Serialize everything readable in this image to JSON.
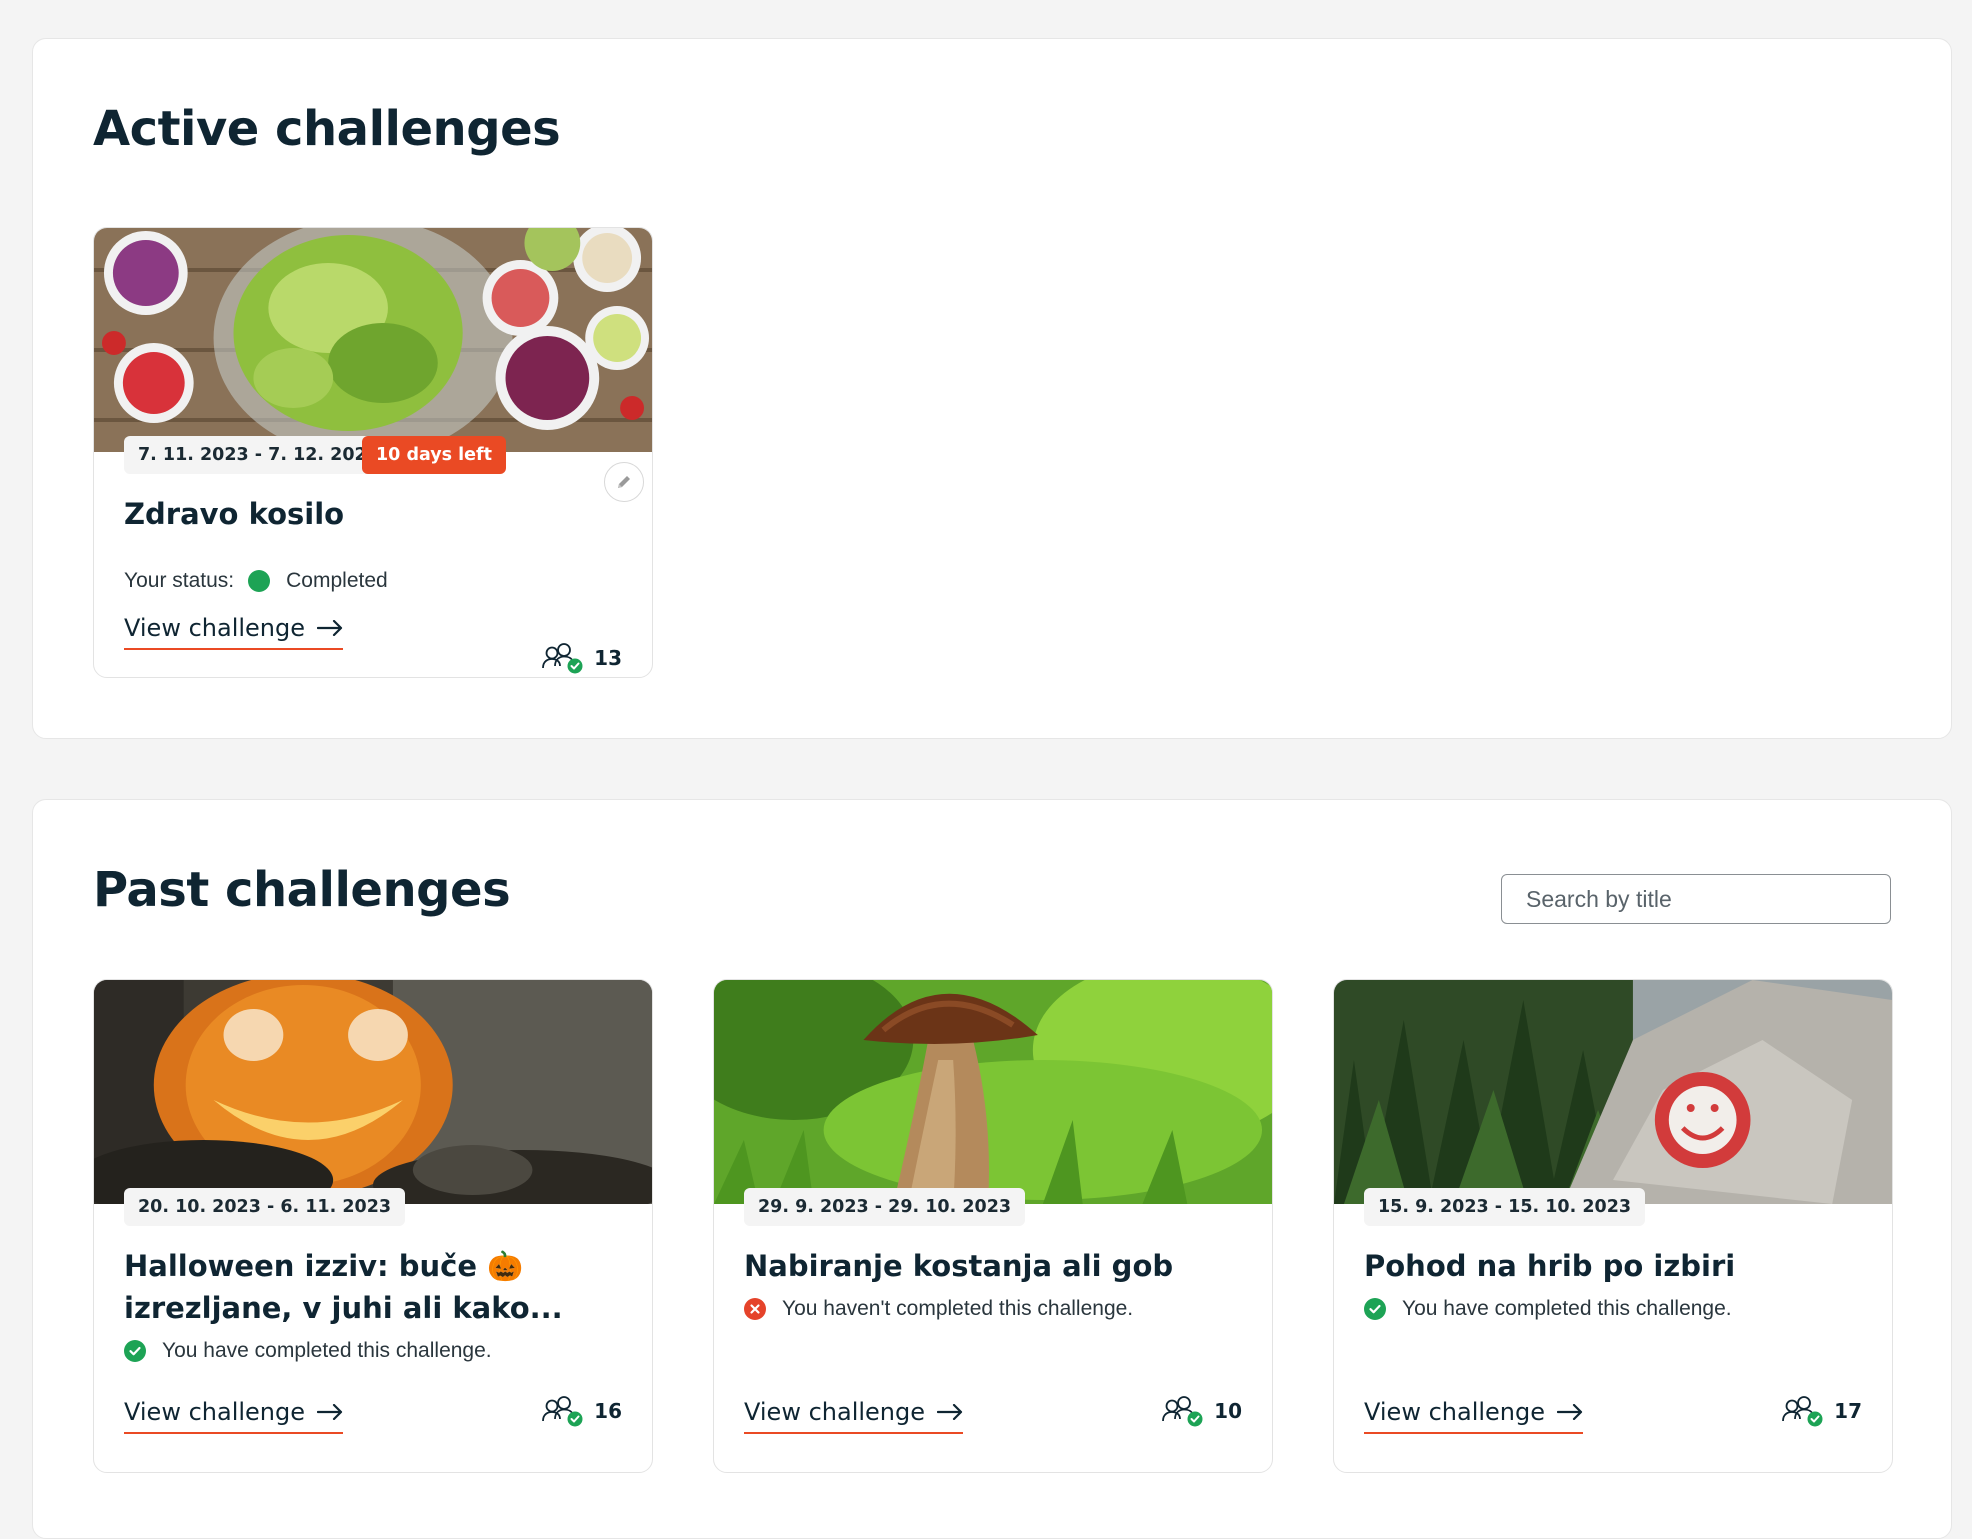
{
  "active": {
    "title": "Active challenges",
    "cards": [
      {
        "date_range": "7. 11. 2023 - 7. 12. 2023",
        "days_left": "10 days left",
        "title": "Zdravo kosilo",
        "status_label": "Your status:",
        "status_value": "Completed",
        "status_color": "#1da355",
        "view_label": "View challenge",
        "participants": "13"
      }
    ]
  },
  "past": {
    "title": "Past challenges",
    "search_placeholder": "Search by title",
    "cards": [
      {
        "date_range": "20. 10. 2023 - 6. 11. 2023",
        "title": "Halloween izziv: buče 🎃 izrezljane, v juhi ali kako...",
        "status_text": "You have completed this challenge.",
        "status_icon": "check-circle-icon",
        "view_label": "View challenge",
        "participants": "16"
      },
      {
        "date_range": "29. 9. 2023 - 29. 10. 2023",
        "title": "Nabiranje kostanja ali gob",
        "status_text": "You haven't completed this challenge.",
        "status_icon": "x-circle-icon",
        "view_label": "View challenge",
        "participants": "10"
      },
      {
        "date_range": "15. 9. 2023 - 15. 10. 2023",
        "title": "Pohod na hrib po izbiri",
        "status_text": "You have completed this challenge.",
        "status_icon": "check-circle-icon",
        "view_label": "View challenge",
        "participants": "17"
      }
    ]
  },
  "colors": {
    "accent": "#ea4a24",
    "success": "#1da355",
    "error": "#e5432a",
    "heading": "#0f2532"
  }
}
